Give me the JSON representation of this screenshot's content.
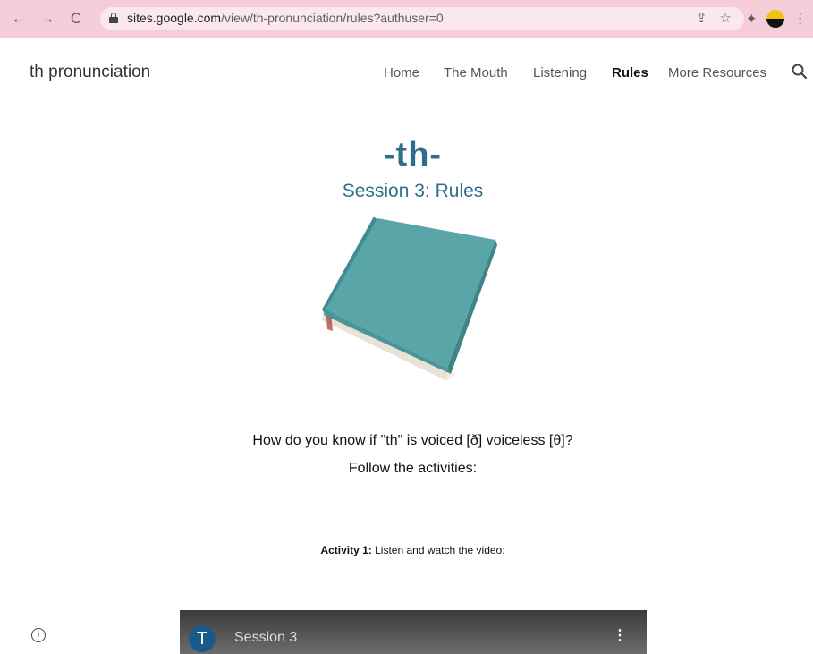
{
  "browser": {
    "url_host": "sites.google.com",
    "url_path": "/view/th-pronunciation/rules?authuser=0",
    "back_icon": "←",
    "forward_icon": "→",
    "reload_icon": "C",
    "share_icon": "⇪",
    "star_icon": "☆",
    "extensions_icon": "✦",
    "menu_icon": "⋮"
  },
  "site": {
    "title": "th pronunciation",
    "nav": [
      {
        "label": "Home"
      },
      {
        "label": "The Mouth"
      },
      {
        "label": "Listening"
      },
      {
        "label": "Rules",
        "active": true
      },
      {
        "label": "More Resources"
      }
    ]
  },
  "main": {
    "heading": "-th-",
    "subheading": "Session 3: Rules",
    "question": "How do you know if  \"th\"  is voiced  [ð] voiceless [θ]?",
    "instruction": "Follow the activities:",
    "activity_label": "Activity 1:",
    "activity_text": " Listen and watch the video:"
  },
  "video": {
    "channel_initial": "T",
    "title": "Session 3",
    "more_icon": "⋮"
  },
  "colors": {
    "chrome": "#f4cdd9",
    "heading": "#2f6e8f",
    "book_cover": "#5aa5a8"
  }
}
